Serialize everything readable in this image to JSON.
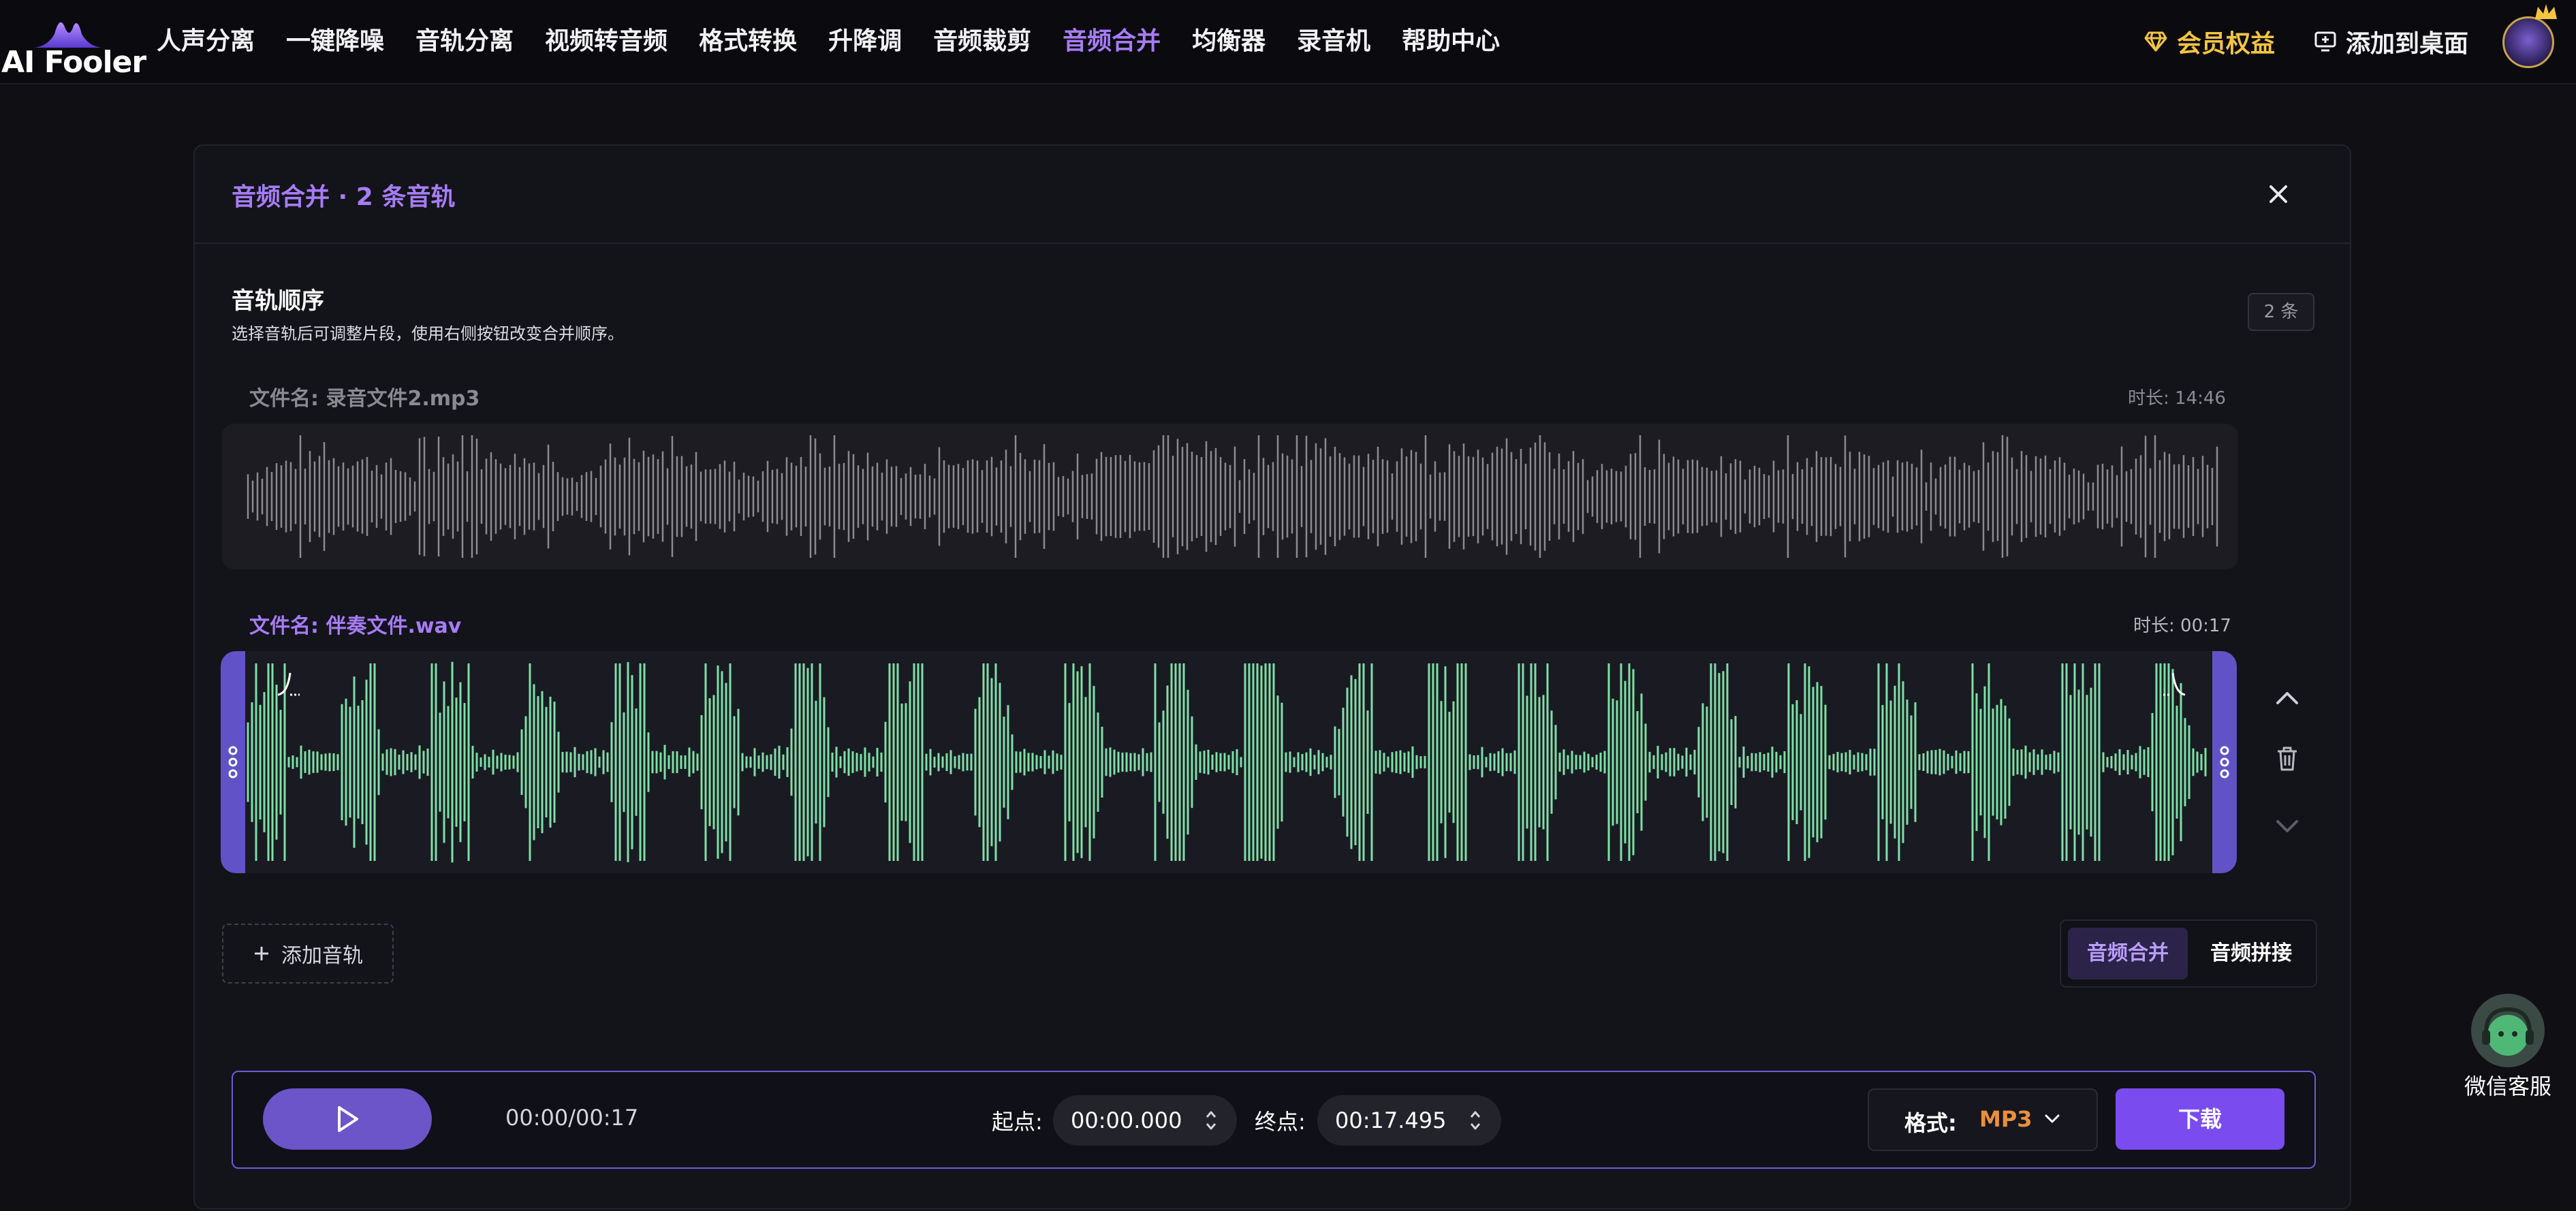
{
  "app": {
    "name": "AI Fooler"
  },
  "nav": {
    "items": [
      {
        "label": "人声分离",
        "active": false
      },
      {
        "label": "一键降噪",
        "active": false
      },
      {
        "label": "音轨分离",
        "active": false
      },
      {
        "label": "视频转音频",
        "active": false
      },
      {
        "label": "格式转换",
        "active": false
      },
      {
        "label": "升降调",
        "active": false
      },
      {
        "label": "音频裁剪",
        "active": false
      },
      {
        "label": "音频合并",
        "active": true
      },
      {
        "label": "均衡器",
        "active": false
      },
      {
        "label": "录音机",
        "active": false
      },
      {
        "label": "帮助中心",
        "active": false
      }
    ],
    "vip_label": "会员权益",
    "add_desktop_label": "添加到桌面"
  },
  "panel": {
    "title": "音频合并 · 2 条音轨",
    "section_title": "音轨顺序",
    "section_desc": "选择音轨后可调整片段，使用右侧按钮改变合并顺序。",
    "count_badge": "2 条",
    "tracks": [
      {
        "filename": "文件名: 录音文件2.mp3",
        "duration": "时长: 14:46",
        "selected": false
      },
      {
        "filename": "文件名: 伴奏文件.wav",
        "duration": "时长: 00:17",
        "selected": true
      }
    ],
    "add_track_label": "添加音轨",
    "modes": [
      "音频合并",
      "音频拼接"
    ],
    "active_mode": "音频合并"
  },
  "player": {
    "time": "00:00/00:17",
    "start_label": "起点:",
    "start_value": "00:00.000",
    "end_label": "终点:",
    "end_value": "00:17.495",
    "format_label": "格式:",
    "format_value": "MP3",
    "download_label": "下载"
  },
  "support": {
    "label": "微信客服"
  },
  "colors": {
    "accent": "#a67cf7",
    "wave_selected": "#7ee0a6",
    "wave_unselected": "#8a8a90",
    "handle": "#6252c7",
    "download": "#7a4cf0",
    "vip": "#f5c542",
    "format_value": "#e8903c"
  },
  "icons": [
    "logo-icon",
    "diamond-icon",
    "add-desktop-icon",
    "avatar",
    "close-icon",
    "move-up-icon",
    "delete-icon",
    "move-down-icon",
    "plus-icon",
    "play-icon",
    "stepper-icon",
    "chevron-down-icon",
    "headset-icon"
  ]
}
